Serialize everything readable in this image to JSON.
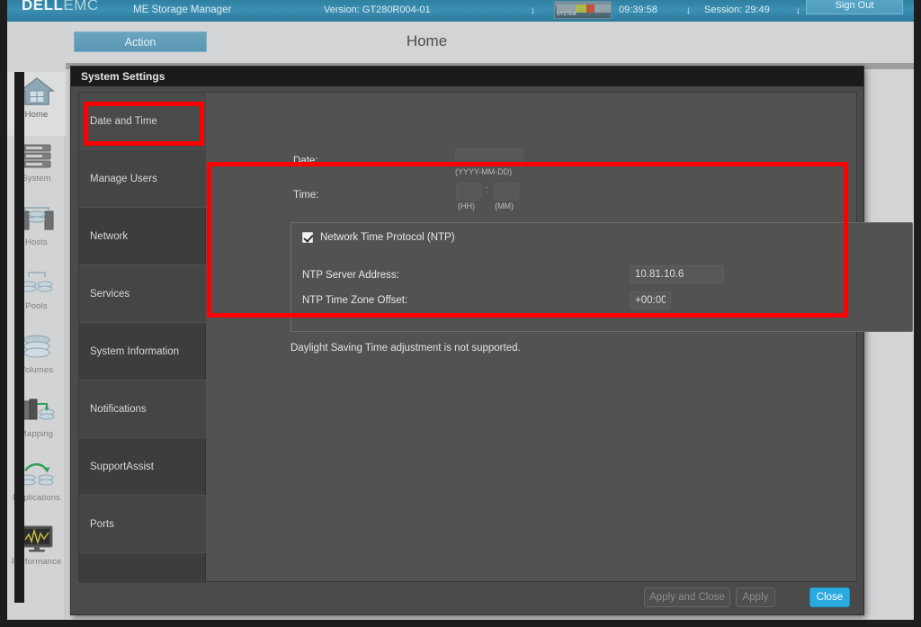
{
  "topbar": {
    "brand_dell": "DELL",
    "brand_emc": "EMC",
    "app_title": "ME Storage Manager",
    "version": "Version: GT280R004-01",
    "clock": "09:39:58",
    "session": "Session: 29:49",
    "sign_out": "Sign Out",
    "health_label": "SYSTEM",
    "arrow_icon": "↓",
    "accent_bar": "#3b90b3"
  },
  "rail": {
    "items": [
      {
        "label": "Home",
        "icon": "home-icon",
        "active": true
      },
      {
        "label": "System",
        "icon": "system-icon",
        "active": false
      },
      {
        "label": "Hosts",
        "icon": "hosts-icon",
        "active": false
      },
      {
        "label": "Pools",
        "icon": "pools-icon",
        "active": false
      },
      {
        "label": "Volumes",
        "icon": "volumes-icon",
        "active": false
      },
      {
        "label": "Mapping",
        "icon": "mapping-icon",
        "active": false
      },
      {
        "label": "Replications",
        "icon": "replications-icon",
        "active": false
      },
      {
        "label": "Performance",
        "icon": "performance-icon",
        "active": false
      }
    ]
  },
  "content": {
    "action_button": "Action",
    "page_title": "Home"
  },
  "dialog": {
    "title": "System Settings",
    "tabs": [
      {
        "label": "Date and Time",
        "selected": true
      },
      {
        "label": "Manage Users",
        "selected": false
      },
      {
        "label": "Network",
        "selected": false
      },
      {
        "label": "Services",
        "selected": false
      },
      {
        "label": "System Information",
        "selected": false
      },
      {
        "label": "Notifications",
        "selected": false
      },
      {
        "label": "SupportAssist",
        "selected": false
      },
      {
        "label": "Ports",
        "selected": false
      }
    ],
    "date_time": {
      "date_label": "Date:",
      "date_value": "",
      "date_hint": "(YYYY-MM-DD)",
      "time_label": "Time:",
      "time_hour_value": "",
      "time_minute_value": "",
      "time_separator": ":",
      "hour_hint": "(HH)",
      "minute_hint": "(MM)"
    },
    "ntp": {
      "checkbox_label": "Network Time Protocol (NTP)",
      "checked": true,
      "server_label": "NTP Server Address:",
      "server_value": "10.81.10.6",
      "offset_label": "NTP Time Zone Offset:",
      "offset_value": "+00:00"
    },
    "dst_note": "Daylight Saving Time adjustment is not supported.",
    "footer": {
      "apply_and_close": "Apply and Close",
      "apply": "Apply",
      "close": "Close",
      "close_color": "#29abe2"
    }
  },
  "annotations": {
    "highlight_color": "#fe0000",
    "boxes": [
      {
        "name": "date-and-time-tab-highlight"
      },
      {
        "name": "ntp-section-highlight"
      }
    ]
  }
}
